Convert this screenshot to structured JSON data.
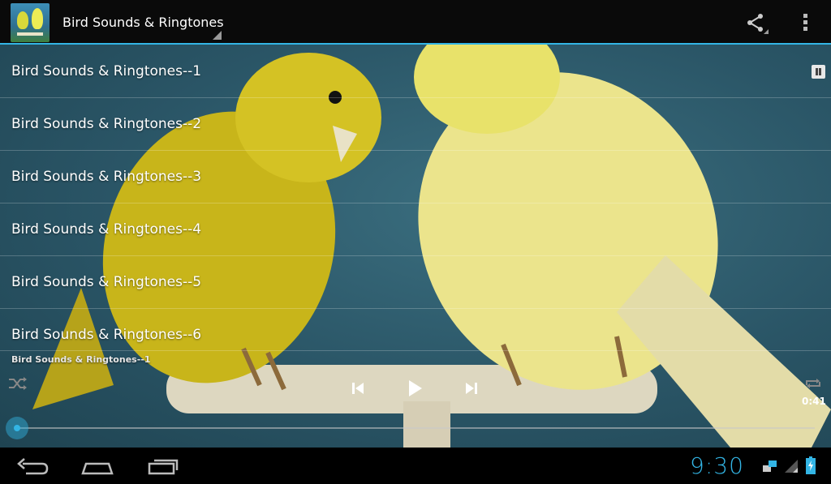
{
  "app": {
    "title": "Bird Sounds & Ringtones",
    "accent_color": "#33b5e5",
    "icon": "app-icon-canaries"
  },
  "actionbar": {
    "share_icon": "share-icon",
    "overflow_icon": "overflow-menu-icon"
  },
  "list": {
    "items": [
      {
        "label": "Bird Sounds & Ringtones--1",
        "playing": true
      },
      {
        "label": "Bird Sounds & Ringtones--2"
      },
      {
        "label": "Bird Sounds & Ringtones--3"
      },
      {
        "label": "Bird Sounds & Ringtones--4"
      },
      {
        "label": "Bird Sounds & Ringtones--5"
      },
      {
        "label": "Bird Sounds & Ringtones--6"
      }
    ]
  },
  "player": {
    "now_playing": "Bird Sounds & Ringtones--1",
    "duration": "0:41",
    "progress": 0.0,
    "controls": [
      "shuffle-icon",
      "previous-icon",
      "play-icon",
      "next-icon",
      "repeat-icon"
    ]
  },
  "systembar": {
    "clock": "9:30",
    "nav": [
      "back-icon",
      "home-icon",
      "recents-icon"
    ],
    "status_icons": [
      "network-icon",
      "signal-icon",
      "battery-charging-icon"
    ]
  }
}
